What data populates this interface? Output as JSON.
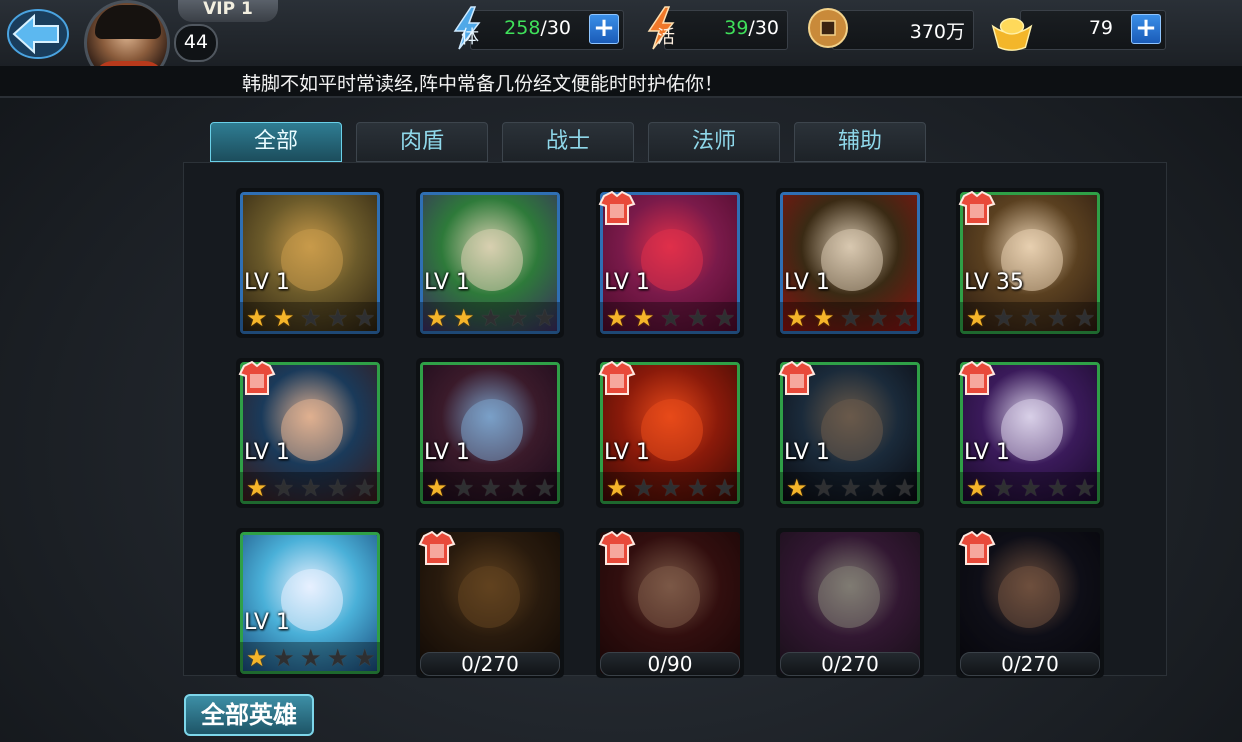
{
  "player": {
    "vip": "VIP 1",
    "level": "44"
  },
  "resources": {
    "stamina": {
      "icon_label": "体",
      "current": "258",
      "max": "/30"
    },
    "energy": {
      "icon_label": "活",
      "current": "39",
      "max": "/30"
    },
    "coins": {
      "value": "370万"
    },
    "gold": {
      "value": "79"
    }
  },
  "marquee": "韩脚不如平时常读经,阵中常备几份经文便能时时护佑你！",
  "tabs": [
    "全部",
    "肉盾",
    "战士",
    "法师",
    "辅助"
  ],
  "active_tab": "全部",
  "heroes": [
    {
      "level": "LV 1",
      "stars": 2,
      "border": "blue",
      "armor": false
    },
    {
      "level": "LV 1",
      "stars": 2,
      "border": "blue",
      "armor": false
    },
    {
      "level": "LV 1",
      "stars": 2,
      "border": "blue",
      "armor": true
    },
    {
      "level": "LV 1",
      "stars": 2,
      "border": "blue",
      "armor": false
    },
    {
      "level": "LV 35",
      "stars": 1,
      "border": "green",
      "armor": true
    },
    {
      "level": "LV 1",
      "stars": 1,
      "border": "green",
      "armor": true
    },
    {
      "level": "LV 1",
      "stars": 1,
      "border": "green",
      "armor": false
    },
    {
      "level": "LV 1",
      "stars": 1,
      "border": "green",
      "armor": true
    },
    {
      "level": "LV 1",
      "stars": 1,
      "border": "green",
      "armor": true
    },
    {
      "level": "LV 1",
      "stars": 1,
      "border": "green",
      "armor": true
    },
    {
      "level": "LV 1",
      "stars": 1,
      "border": "green",
      "armor": false
    }
  ],
  "fragments": [
    {
      "progress": "0/270",
      "armor": true
    },
    {
      "progress": "0/90",
      "armor": true
    },
    {
      "progress": "0/270",
      "armor": false
    },
    {
      "progress": "0/270",
      "armor": true
    }
  ],
  "all_heroes_button": "全部英雄",
  "colors": {
    "tab_active": "#2f7d93",
    "star_on": "#f5b52a",
    "border_blue": "#2f6fb4",
    "border_green": "#2fa047"
  }
}
